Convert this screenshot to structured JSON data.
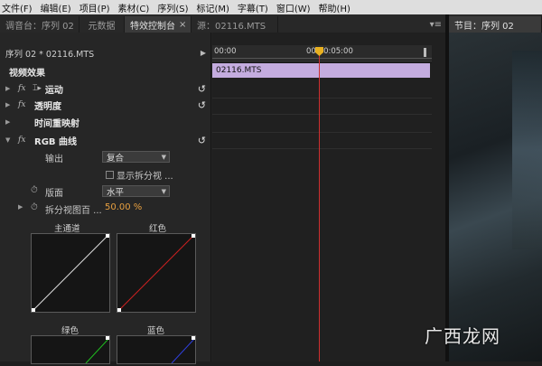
{
  "menu": [
    "文件(F)",
    "编辑(E)",
    "项目(P)",
    "素材(C)",
    "序列(S)",
    "标记(M)",
    "字幕(T)",
    "窗口(W)",
    "帮助(H)"
  ],
  "tabs_left": [
    {
      "label": "调音台：序列 02"
    },
    {
      "label": "元数据"
    },
    {
      "label": "特效控制台"
    },
    {
      "label": "源：02116.MTS"
    }
  ],
  "tab_close": "×",
  "panel_menu": "▾≡",
  "tab_right": "节目：序列 02",
  "seq_header": "序列 02 * 02116.MTS",
  "video_effects": "视频效果",
  "effects": [
    {
      "name": "运动",
      "fx": "fx",
      "icon": "motion-icon"
    },
    {
      "name": "透明度",
      "fx": "fx"
    },
    {
      "name": "时间重映射",
      "fx": ""
    },
    {
      "name": "RGB 曲线",
      "fx": "fx"
    }
  ],
  "params": {
    "output_label": "输出",
    "output_value": "复合",
    "show_split_label": "显示拆分视 ...",
    "layout_label": "版面",
    "layout_value": "水平",
    "split_pct_label": "拆分视图百 ...",
    "split_pct_value": "50.00 %"
  },
  "curves": [
    "主通道",
    "红色",
    "绿色",
    "蓝色"
  ],
  "timeline": {
    "t_start": "00:00",
    "t_mid": "00:00:05:00",
    "clip_name": "02116.MTS"
  },
  "watermark": "广西龙网",
  "colors": {
    "playhead": "#cf2f2f",
    "clip": "#c4acdf",
    "value": "#e8a040"
  }
}
